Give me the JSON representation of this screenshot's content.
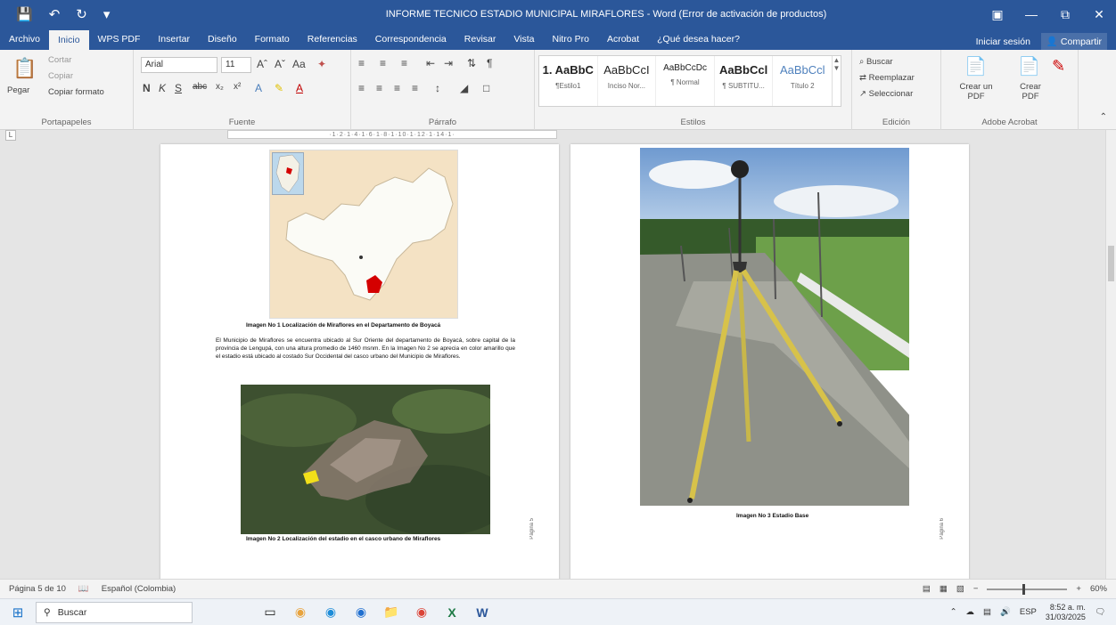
{
  "window": {
    "title": "INFORME TECNICO ESTADIO MUNICIPAL MIRAFLORES - Word (Error de activación de productos)"
  },
  "tabs": [
    {
      "label": "Archivo"
    },
    {
      "label": "Inicio"
    },
    {
      "label": "WPS PDF"
    },
    {
      "label": "Insertar"
    },
    {
      "label": "Diseño"
    },
    {
      "label": "Formato"
    },
    {
      "label": "Referencias"
    },
    {
      "label": "Correspondencia"
    },
    {
      "label": "Revisar"
    },
    {
      "label": "Vista"
    },
    {
      "label": "Nitro Pro"
    },
    {
      "label": "Acrobat"
    },
    {
      "label": "¿Qué desea hacer?"
    }
  ],
  "account": {
    "signin": "Iniciar sesión",
    "share": "Compartir"
  },
  "ribbon": {
    "clipboard": {
      "paste": "Pegar",
      "cut": "Cortar",
      "copy": "Copiar",
      "format_painter": "Copiar formato",
      "label": "Portapapeles"
    },
    "font": {
      "name": "Arial",
      "size": "11",
      "label": "Fuente"
    },
    "paragraph": {
      "label": "Párrafo"
    },
    "styles": {
      "label": "Estilos",
      "items": [
        {
          "sample": "1. AaBbC",
          "name": "¶Estilo1"
        },
        {
          "sample": "AaBbCcI",
          "name": "Inciso Nor..."
        },
        {
          "sample": "AaBbCcDc",
          "name": "¶ Normal"
        },
        {
          "sample": "AaBbCcl",
          "name": "¶ SUBTITU..."
        },
        {
          "sample": "AaBbCcl",
          "name": "Título 2"
        }
      ]
    },
    "editing": {
      "find": "Buscar",
      "replace": "Reemplazar",
      "select": "Seleccionar",
      "label": "Edición"
    },
    "acrobat": {
      "create_share": "Crear un PDF",
      "create_pdf": "Crear PDF",
      "label": "Adobe Acrobat"
    }
  },
  "document": {
    "page1": {
      "caption1": "Imagen No 1 Localización de Miraflores en el Departamento de Boyacá",
      "paragraph": "El Municipio de Miraflores se encuentra ubicado al Sur Oriente del departamento de Boyacá, sobre capital de la provincia de Lengupá, con una altura promedio de 1460 msnm. En la Imagen No 2 se aprecia en color amarillo que el estadio está ubicado al costado Sur Occidental del casco urbano del Municipio de Miraflores.",
      "caption2": "Imagen No 2 Localización del estadio en el casco urbano de Miraflores",
      "page_label": "Página 5"
    },
    "page2": {
      "caption": "Imagen No 3 Estadio Base",
      "page_label": "Página 6"
    }
  },
  "statusbar": {
    "page": "Página 5 de 10",
    "language": "Español (Colombia)",
    "zoom": "60%"
  },
  "taskbar": {
    "search_placeholder": "Buscar",
    "lang": "ESP",
    "time": "8:52 a. m.",
    "date": "31/03/2025"
  }
}
